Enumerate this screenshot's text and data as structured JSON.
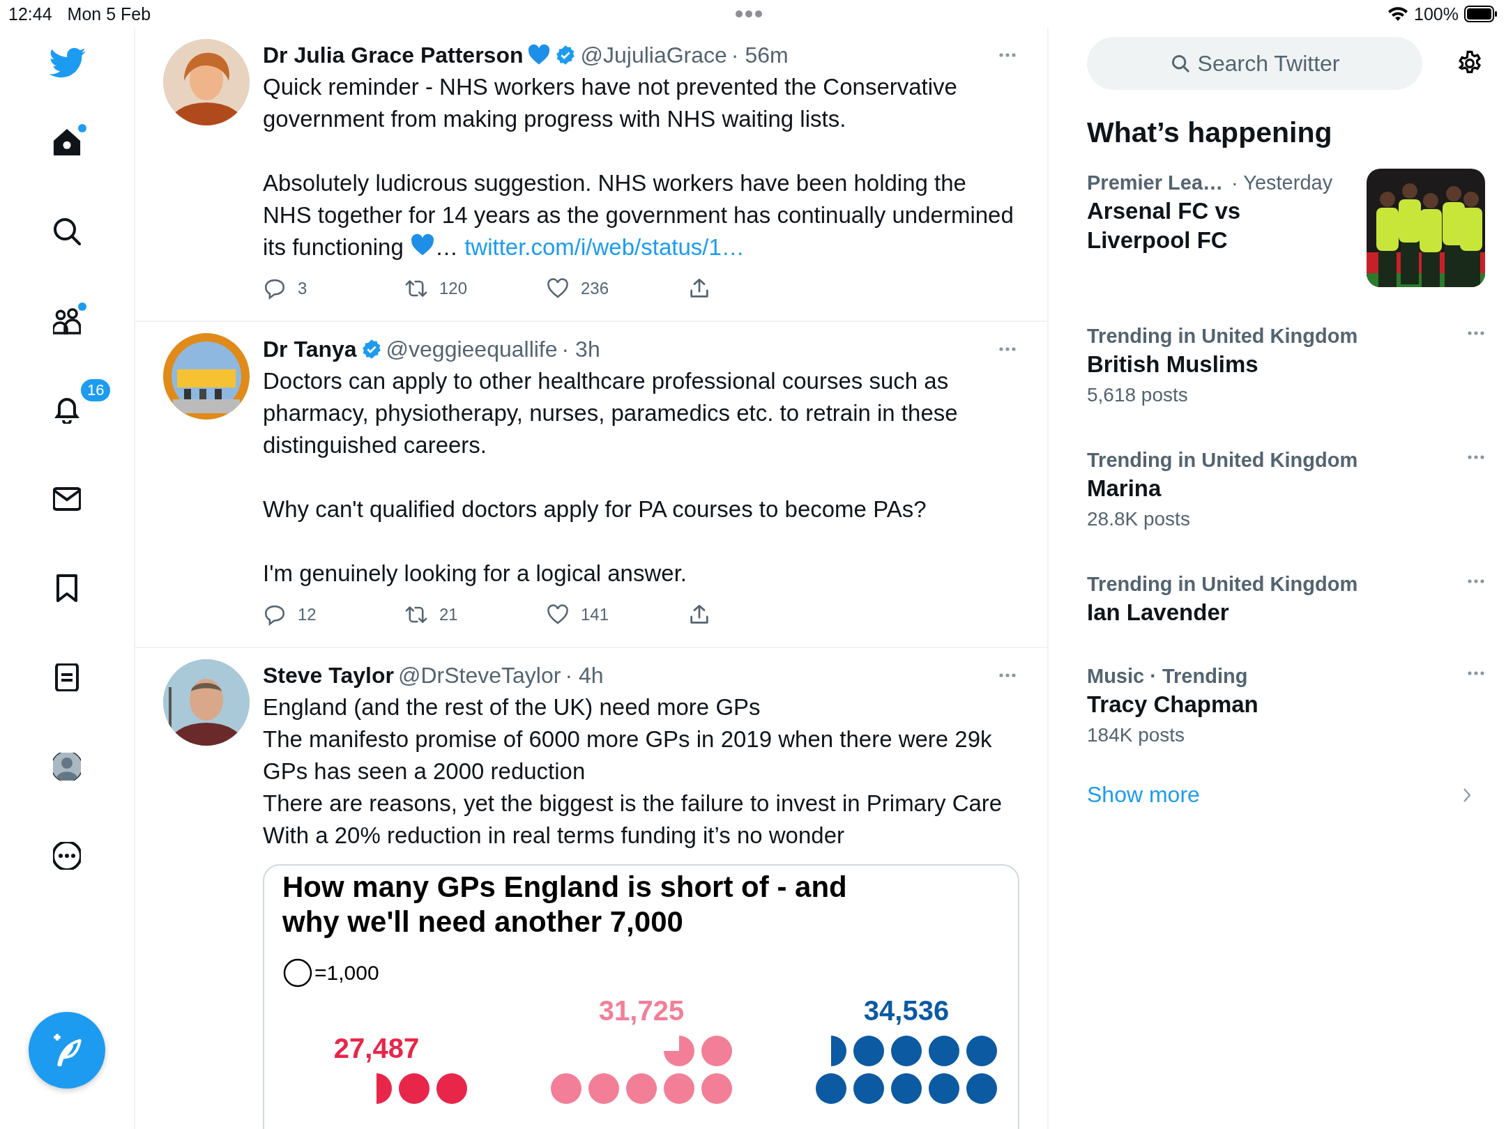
{
  "status_bar": {
    "time": "12:44",
    "date": "Mon 5 Feb",
    "battery": "100%"
  },
  "nav": {
    "items": [
      {
        "kind": "home",
        "selected": true,
        "dot": true
      },
      {
        "kind": "search",
        "selected": false,
        "dot": false
      },
      {
        "kind": "communities",
        "selected": false,
        "dot": true
      },
      {
        "kind": "notifications",
        "selected": false,
        "dot": false,
        "badge": "16"
      },
      {
        "kind": "messages",
        "selected": false,
        "dot": false
      },
      {
        "kind": "bookmarks",
        "selected": false,
        "dot": false
      },
      {
        "kind": "lists",
        "selected": false,
        "dot": false
      },
      {
        "kind": "profile",
        "selected": false,
        "dot": false
      },
      {
        "kind": "more",
        "selected": false,
        "dot": false
      }
    ]
  },
  "tweets": [
    {
      "name": "Dr Julia Grace Patterson",
      "name_heart": true,
      "verified": true,
      "handle": "@JujuliaGrace",
      "time": "· 56m",
      "paragraphs": [
        [
          {
            "kind": "text",
            "text": "Quick reminder - NHS workers have not prevented the Conservative government from making progress with NHS waiting lists."
          }
        ],
        [
          {
            "kind": "text",
            "text": "Absolutely ludicrous suggestion. NHS workers have been holding the NHS together for 14 years as the government has continually undermined its functioning "
          },
          {
            "kind": "heart"
          },
          {
            "kind": "text",
            "text": "… "
          },
          {
            "kind": "link",
            "text": "twitter.com/i/web/status/1…"
          }
        ]
      ],
      "replies": "3",
      "retweets": "120",
      "likes": "236"
    },
    {
      "name": "Dr Tanya",
      "name_heart": false,
      "verified": true,
      "handle": "@veggieequallife",
      "time": "· 3h",
      "paragraphs": [
        [
          {
            "kind": "text",
            "text": "Doctors can apply to other healthcare professional courses such as pharmacy, physiotherapy, nurses, paramedics etc. to retrain in these distinguished careers."
          }
        ],
        [
          {
            "kind": "text",
            "text": "Why can't qualified doctors apply for PA courses to become PAs?"
          }
        ],
        [
          {
            "kind": "text",
            "text": "I'm genuinely looking for a logical answer."
          }
        ]
      ],
      "replies": "12",
      "retweets": "21",
      "likes": "141"
    },
    {
      "name": "Steve Taylor",
      "name_heart": false,
      "verified": false,
      "handle": "@DrSteveTaylor",
      "time": "· 4h",
      "paragraphs": [
        [
          {
            "kind": "text",
            "text": "England (and the rest of the UK) need more GPs\nThe manifesto promise of 6000 more GPs in 2019 when there were 29k GPs has seen a 2000 reduction\nThere are reasons, yet the biggest is the failure to invest in Primary Care\nWith a 20% reduction in real terms funding it’s no wonder"
          }
        ]
      ],
      "card": {
        "title": "How many GPs England is short of - and why we'll need another 7,000",
        "legend": "=1,000",
        "groups": [
          {
            "value": "27,487",
            "color": "#e8264a",
            "rows": [
              [
                {
                  "kind": "half"
                },
                {
                  "kind": "full"
                },
                {
                  "kind": "full"
                }
              ]
            ]
          },
          {
            "value": "31,725",
            "color": "#f27f97",
            "rows": [
              [
                {
                  "kind": "three_quarter"
                },
                {
                  "kind": "full"
                }
              ],
              [
                {
                  "kind": "full"
                },
                {
                  "kind": "full"
                },
                {
                  "kind": "full"
                },
                {
                  "kind": "full"
                },
                {
                  "kind": "full"
                }
              ]
            ]
          },
          {
            "value": "34,536",
            "color": "#0b5aa2",
            "rows": [
              [
                {
                  "kind": "half"
                },
                {
                  "kind": "full"
                },
                {
                  "kind": "full"
                },
                {
                  "kind": "full"
                },
                {
                  "kind": "full"
                }
              ],
              [
                {
                  "kind": "full"
                },
                {
                  "kind": "full"
                },
                {
                  "kind": "full"
                },
                {
                  "kind": "full"
                },
                {
                  "kind": "full"
                }
              ]
            ]
          }
        ]
      }
    }
  ],
  "trends": {
    "title": "What’s happening",
    "search_placeholder": "Search Twitter",
    "items": [
      {
        "kind": "news",
        "category": "Premier Lea…",
        "meta": "· Yesterday",
        "title": "Arsenal FC vs Liverpool FC"
      },
      {
        "kind": "trend",
        "category": "Trending in United Kingdom",
        "title": "British Muslims",
        "posts": "5,618 posts"
      },
      {
        "kind": "trend",
        "category": "Trending in United Kingdom",
        "title": "Marina",
        "posts": "28.8K posts"
      },
      {
        "kind": "trend",
        "category": "Trending in United Kingdom",
        "title": "Ian Lavender"
      },
      {
        "kind": "trend",
        "category": "Music · Trending",
        "title": "Tracy Chapman",
        "posts": "184K posts"
      }
    ],
    "show_more": "Show more"
  }
}
